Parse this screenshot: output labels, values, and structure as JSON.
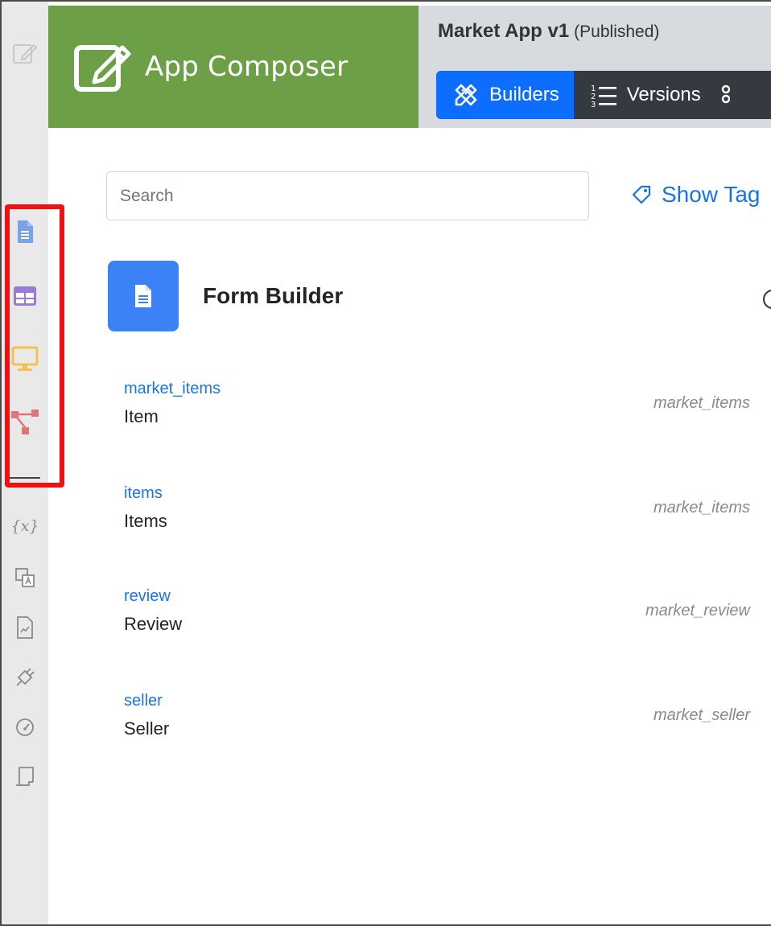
{
  "header": {
    "brand_title": "App Composer",
    "app_name": "Market App v1",
    "app_status": "(Published)",
    "tabs": [
      {
        "label": "Builders",
        "icon": "pencil-ruler-icon",
        "active": true
      },
      {
        "label": "Versions",
        "icon": "list-numbered-icon",
        "active": false
      }
    ]
  },
  "sidebar": {
    "items": [
      {
        "icon": "edit-icon",
        "color": "#c8c8c8"
      },
      {
        "icon": "form-document-icon",
        "color": "#7aa3e5"
      },
      {
        "icon": "table-icon",
        "color": "#9b7bd8"
      },
      {
        "icon": "monitor-icon",
        "color": "#f2c14e"
      },
      {
        "icon": "workflow-icon",
        "color": "#e57373"
      },
      {
        "icon": "variable-icon",
        "color": "#8a8a8a"
      },
      {
        "icon": "translate-icon",
        "color": "#8a8a8a"
      },
      {
        "icon": "report-icon",
        "color": "#8a8a8a"
      },
      {
        "icon": "plug-icon",
        "color": "#8a8a8a"
      },
      {
        "icon": "gauge-icon",
        "color": "#8a8a8a"
      },
      {
        "icon": "script-icon",
        "color": "#8a8a8a"
      }
    ],
    "variable_glyph": "{x}"
  },
  "main": {
    "search_placeholder": "Search",
    "show_tags_label": "Show Tag",
    "section_title": "Form Builder",
    "forms": [
      {
        "name": "market_items",
        "label": "Item",
        "table": "market_items"
      },
      {
        "name": "items",
        "label": "Items",
        "table": "market_items"
      },
      {
        "name": "review",
        "label": "Review",
        "table": "market_review"
      },
      {
        "name": "seller",
        "label": "Seller",
        "table": "market_seller"
      }
    ]
  },
  "colors": {
    "brand_green": "#6da046",
    "accent_blue": "#0d6efd",
    "link_blue": "#1a73e8",
    "highlight_red": "#ee1111",
    "tab_bar_dark": "#343a40"
  }
}
